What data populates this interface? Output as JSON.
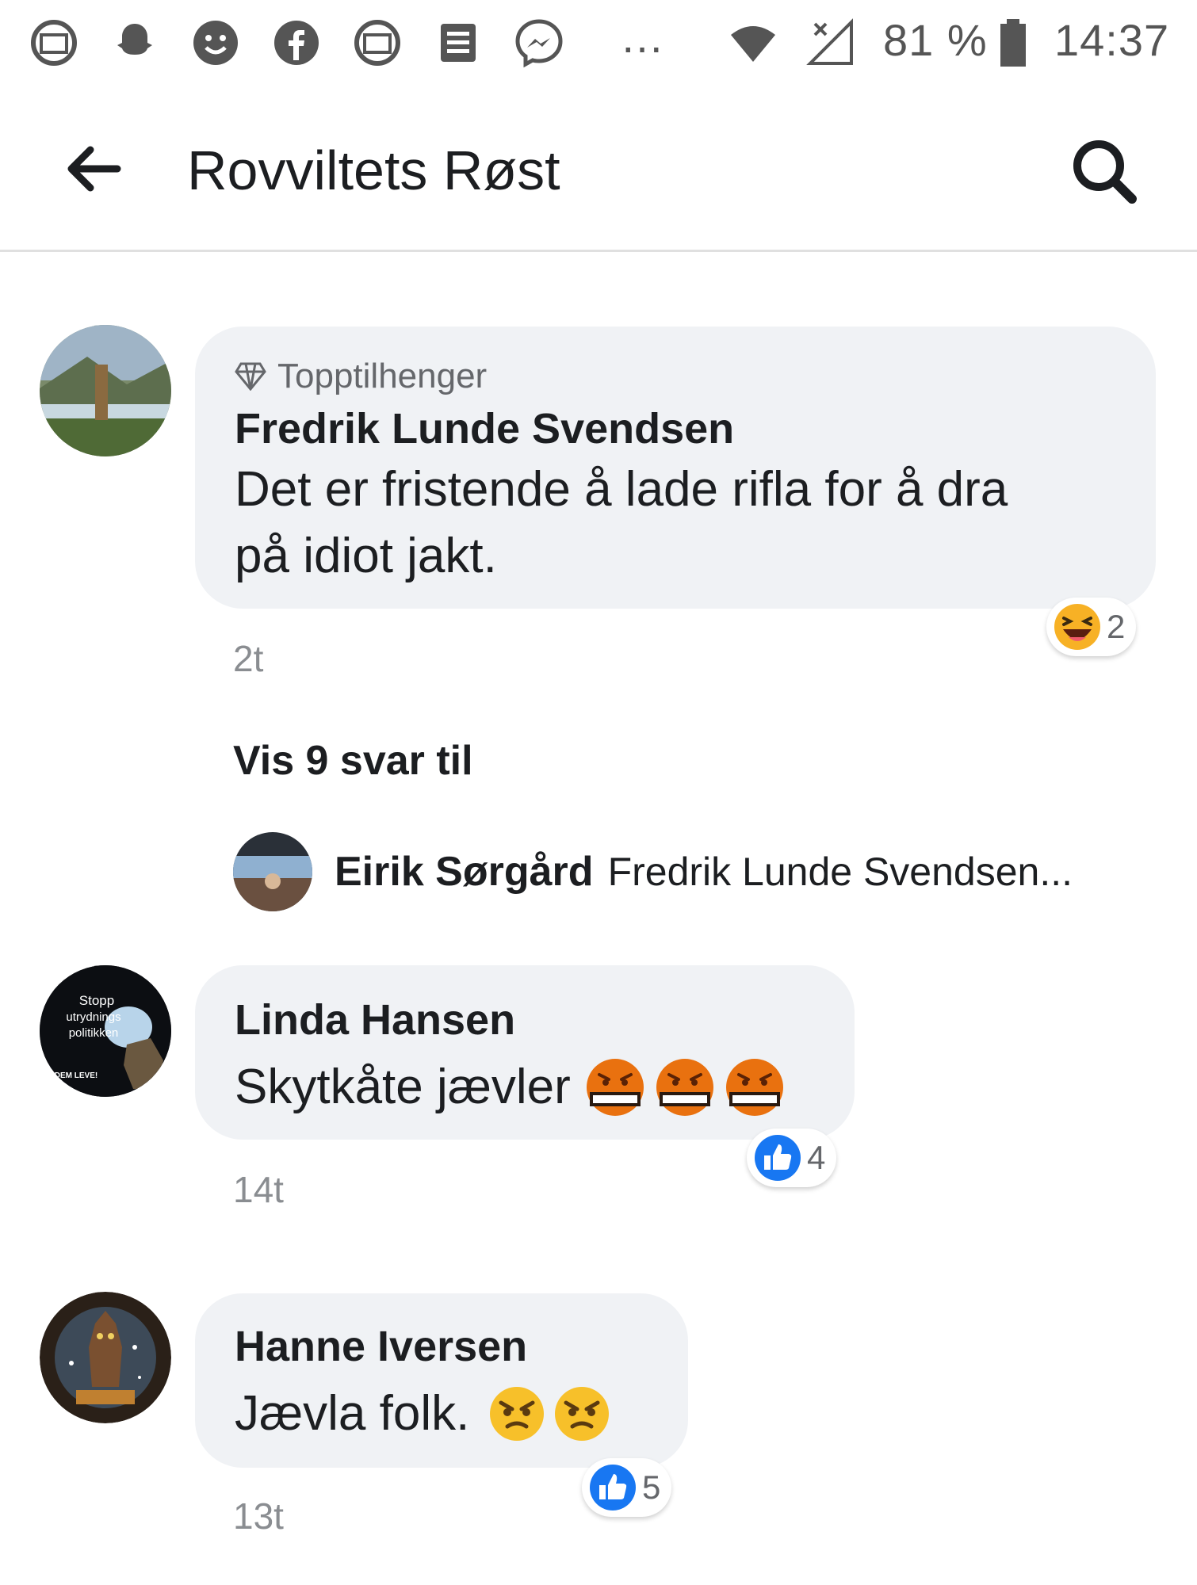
{
  "status_bar": {
    "battery": "81 %",
    "time": "14:37",
    "overflow": "…"
  },
  "header": {
    "title": "Rovviltets Røst"
  },
  "comments": [
    {
      "badge": "Topptilhenger",
      "author": "Fredrik Lunde Svendsen",
      "text_line1": "Det er fristende å lade rifla for å dra",
      "text_line2": "på idiot jakt.",
      "time": "2t",
      "reaction_count": "2",
      "more_replies": "Vis 9 svar til",
      "reply_author": "Eirik Sørgård",
      "reply_snippet": "Fredrik Lunde Svendsen..."
    },
    {
      "author": "Linda Hansen",
      "text": "Skytkåte jævler",
      "time": "14t",
      "reaction_count": "4",
      "avatar_text_1": "Stopp",
      "avatar_text_2": "utrydnings",
      "avatar_text_3": "politikken",
      "avatar_text_4": "DEM LEVE!"
    },
    {
      "author": "Hanne Iversen",
      "text": "Jævla folk.",
      "time": "13t",
      "reaction_count": "5"
    }
  ],
  "colors": {
    "like_blue": "#1877f2",
    "bubble_bg": "#f0f2f5",
    "angry_orange": "#e9710f",
    "haha_yellow": "#f7b125"
  }
}
